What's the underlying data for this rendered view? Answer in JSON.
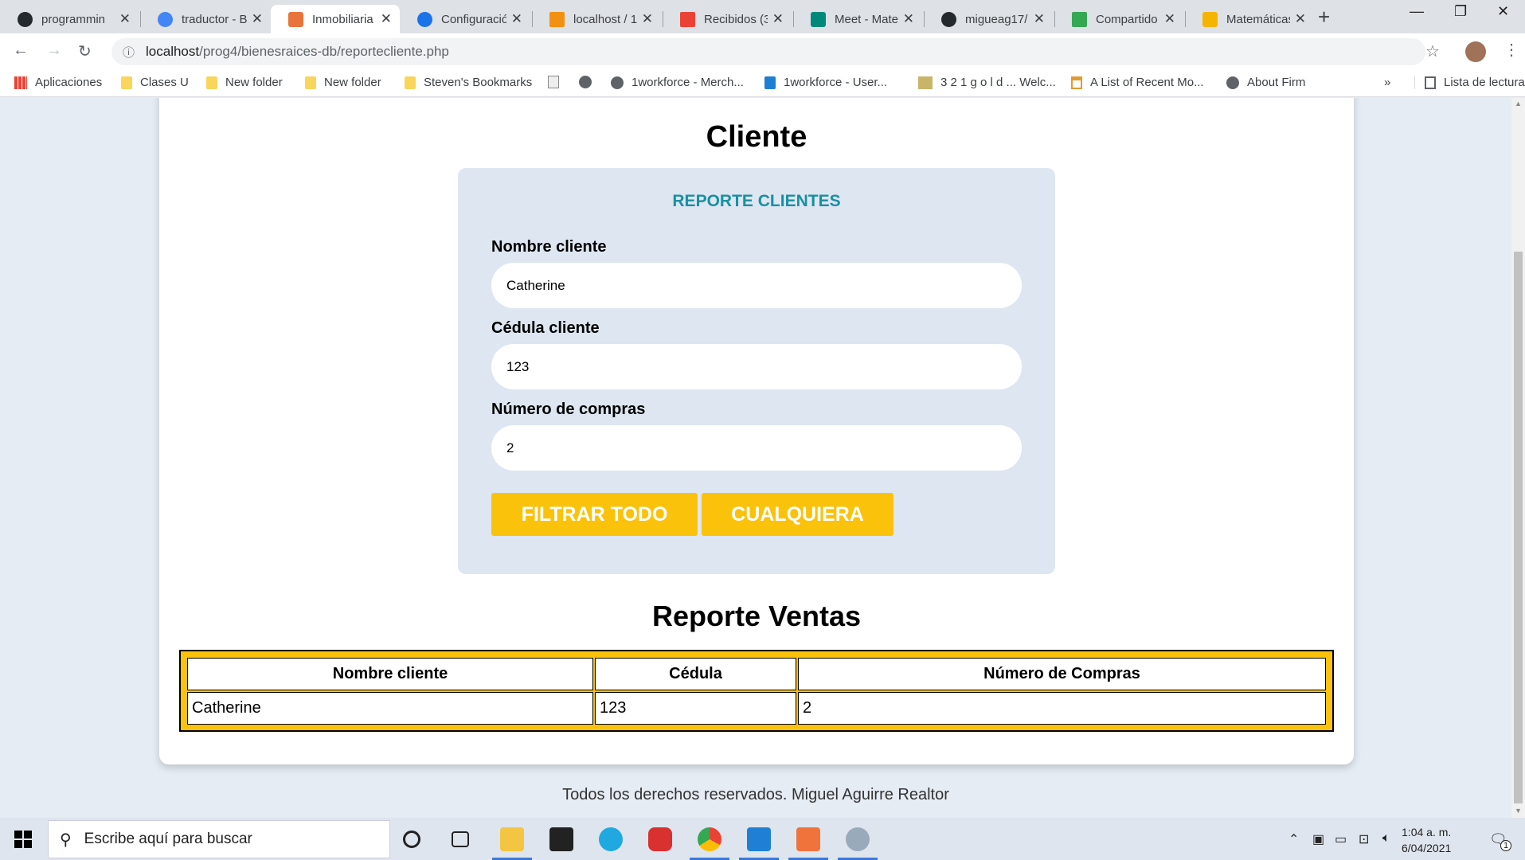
{
  "browser": {
    "tabs": [
      {
        "title": "programmin",
        "color": "#24292e"
      },
      {
        "title": "traductor - B",
        "color": "#4285f4"
      },
      {
        "title": "Inmobiliaria",
        "color": "#e8743b",
        "active": true
      },
      {
        "title": "Configuració",
        "color": "#1a73e8"
      },
      {
        "title": "localhost / 1",
        "color": "#f29111"
      },
      {
        "title": "Recibidos (3",
        "color": "#ea4335"
      },
      {
        "title": "Meet - Mate",
        "color": "#00897b"
      },
      {
        "title": "migueag17/",
        "color": "#24292e"
      },
      {
        "title": "Compartido",
        "color": "#34a853"
      },
      {
        "title": "Matemáticas",
        "color": "#f4b400"
      }
    ],
    "url_host": "localhost",
    "url_path": "/prog4/bienesraices-db/reportecliente.php",
    "bookmarks": [
      {
        "label": "Aplicaciones",
        "icon": "apps-icon"
      },
      {
        "label": "Clases U",
        "icon": "folder-icon"
      },
      {
        "label": "New folder",
        "icon": "folder-icon"
      },
      {
        "label": "New folder",
        "icon": "folder-icon"
      },
      {
        "label": "Steven's Bookmarks",
        "icon": "folder-icon"
      },
      {
        "label": "",
        "icon": "doc-icon"
      },
      {
        "label": "",
        "icon": "globe-icon"
      },
      {
        "label": "1workforce - Merch...",
        "icon": "globe-icon"
      },
      {
        "label": "1workforce - User...",
        "icon": "bird-icon"
      },
      {
        "label": "3 2 1 g o l d ... Welc...",
        "icon": "321-icon"
      },
      {
        "label": "A List of Recent Mo...",
        "icon": "house-icon"
      },
      {
        "label": "About Firm",
        "icon": "globe-icon"
      }
    ],
    "more_bookmarks": "»",
    "reading_list": "Lista de lectura"
  },
  "page": {
    "title": "Cliente",
    "form": {
      "legend": "REPORTE CLIENTES",
      "name_label": "Nombre cliente",
      "name_value": "Catherine",
      "id_label": "Cédula cliente",
      "id_value": "123",
      "purchases_label": "Número de compras",
      "purchases_value": "2",
      "filter_all_label": "FILTRAR TODO",
      "any_label": "CUALQUIERA"
    },
    "report_title": "Reporte Ventas",
    "table": {
      "headers": [
        "Nombre cliente",
        "Cédula",
        "Número de Compras"
      ],
      "rows": [
        [
          "Catherine",
          "123",
          "2"
        ]
      ]
    },
    "footer": "Todos los derechos reservados. Miguel Aguirre Realtor"
  },
  "taskbar": {
    "search_placeholder": "Escribe aquí para buscar",
    "time": "1:04 a. m.",
    "date": "6/04/2021",
    "notification_count": "1"
  },
  "colors": {
    "accent_yellow": "#fbc20b",
    "legend_teal": "#1a8fa3",
    "form_bg": "#dde6f1",
    "page_bg": "#e6ecf4"
  }
}
